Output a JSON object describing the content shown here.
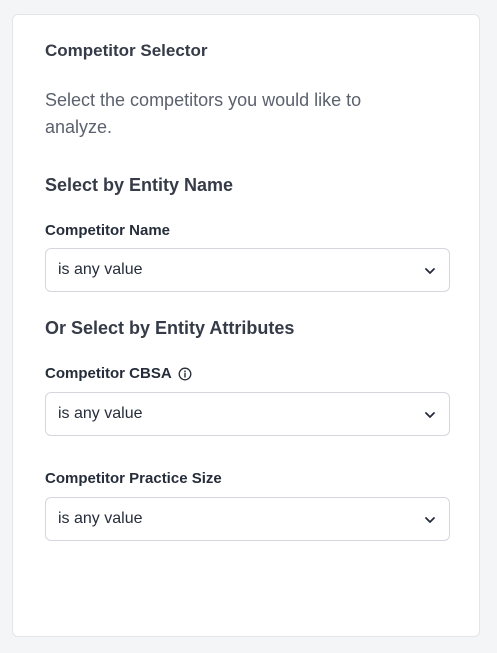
{
  "panel": {
    "title": "Competitor Selector",
    "description": "Select the competitors you would like to analyze."
  },
  "entity_name_section": {
    "heading": "Select by Entity Name",
    "fields": [
      {
        "label": "Competitor Name",
        "value": "is any value",
        "icon": "chevron-down-icon"
      }
    ]
  },
  "entity_attributes_section": {
    "heading": "Or Select by Entity Attributes",
    "fields": [
      {
        "label": "Competitor CBSA",
        "value": "is any value",
        "info_icon": "info-icon",
        "icon": "chevron-down-icon"
      },
      {
        "label": "Competitor Practice Size",
        "value": "is any value",
        "icon": "chevron-down-icon"
      }
    ]
  }
}
